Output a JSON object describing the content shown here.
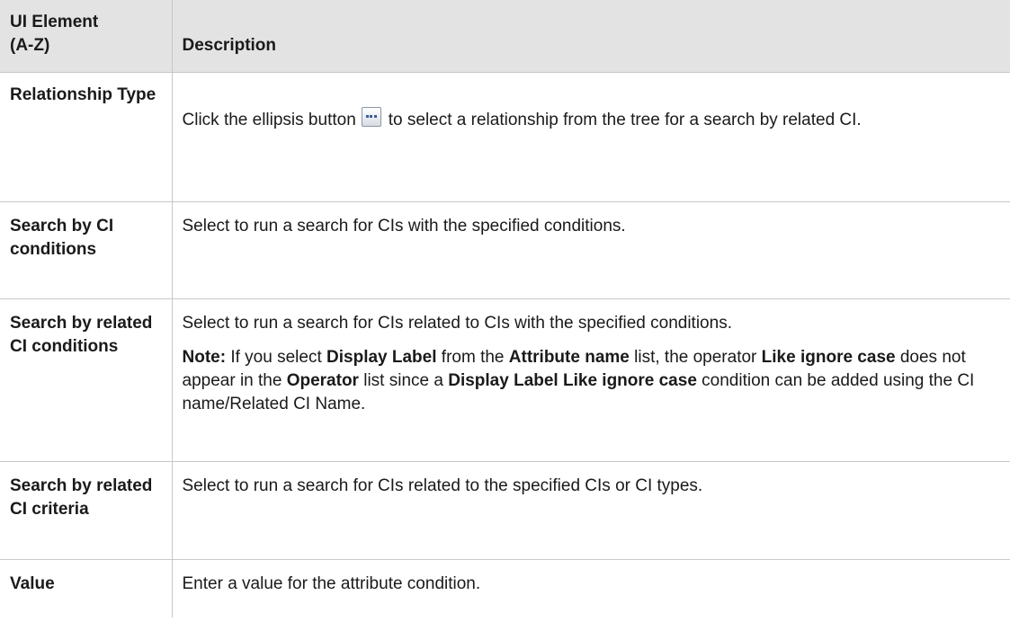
{
  "table": {
    "headers": {
      "element_line1": "UI Element",
      "element_line2": "(A-Z)",
      "description": "Description"
    },
    "rows": [
      {
        "element": "Relationship Type",
        "desc_before_button": "Click the ellipsis button",
        "desc_after_button": "to select a relationship from the tree for a search by related CI.",
        "button_icon": "ellipsis-icon"
      },
      {
        "element": "Search by CI conditions",
        "description": "Select to run a search for CIs with the specified conditions."
      },
      {
        "element": "Search by related CI conditions",
        "description": "Select to run a search for CIs related to CIs with the specified conditions.",
        "note": {
          "label": "Note:",
          "t1": "If you select",
          "b1": "Display Label",
          "t2": "from the",
          "b2": "Attribute name",
          "t3": "list, the operator",
          "b3": "Like ignore case",
          "t4": "does not appear in the",
          "b4": "Operator",
          "t5": "list since a",
          "b5": "Display Label Like ignore case",
          "t6": "condition can be added using the CI name/Related CI Name."
        }
      },
      {
        "element": "Search by related CI criteria",
        "description": "Select to run a search for CIs related to the specified CIs or CI types."
      },
      {
        "element": "Value",
        "description": "Enter a value for the attribute condition."
      }
    ]
  },
  "colors": {
    "header_bg": "#e3e3e3",
    "border": "#c8c8c8",
    "text": "#1a1a1a"
  }
}
